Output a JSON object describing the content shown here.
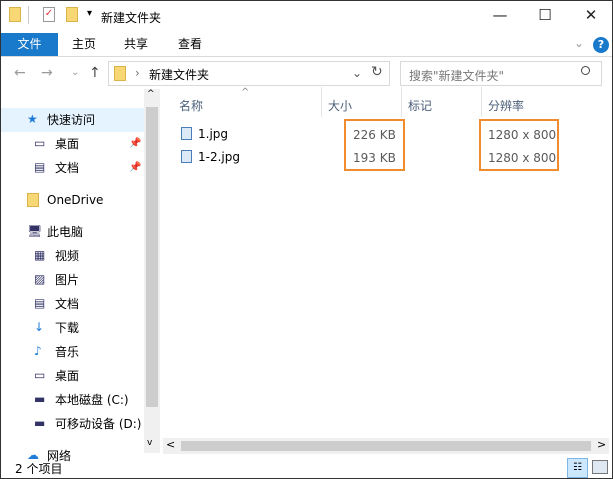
{
  "title_bar": {
    "title": "新建文件夹",
    "minimize": "—",
    "maximize": "☐",
    "close": "✕"
  },
  "ribbon": {
    "tabs": [
      "文件",
      "主页",
      "共享",
      "查看"
    ],
    "help": "?",
    "expand": "⌄"
  },
  "address": {
    "back": "←",
    "forward": "→",
    "recent": "⌄",
    "up": "↑",
    "separator": "›",
    "path": "新建文件夹",
    "dropdown": "⌄",
    "refresh": "↻"
  },
  "search": {
    "placeholder": "搜索\"新建文件夹\"",
    "icon": "search-icon"
  },
  "columns": {
    "name": "名称",
    "size": "大小",
    "tags": "标记",
    "resolution": "分辨率",
    "sort_arrow": "^"
  },
  "files": [
    {
      "name": "1.jpg",
      "size": "226 KB",
      "resolution": "1280 x 800"
    },
    {
      "name": "1-2.jpg",
      "size": "193 KB",
      "resolution": "1280 x 800"
    }
  ],
  "sidebar": {
    "items": [
      {
        "label": "快速访问",
        "icon": "star-icon"
      },
      {
        "label": "桌面",
        "icon": "desktop-icon",
        "pinned": true
      },
      {
        "label": "文档",
        "icon": "document-icon",
        "pinned": true
      },
      {
        "label": "OneDrive",
        "icon": "folder-icon"
      },
      {
        "label": "此电脑",
        "icon": "computer-icon"
      },
      {
        "label": "视频",
        "icon": "video-icon"
      },
      {
        "label": "图片",
        "icon": "picture-icon"
      },
      {
        "label": "文档",
        "icon": "document-icon"
      },
      {
        "label": "下载",
        "icon": "download-icon"
      },
      {
        "label": "音乐",
        "icon": "music-icon"
      },
      {
        "label": "桌面",
        "icon": "desktop-icon"
      },
      {
        "label": "本地磁盘 (C:)",
        "icon": "drive-icon"
      },
      {
        "label": "可移动设备 (D:)",
        "icon": "drive-icon"
      },
      {
        "label": "网络",
        "icon": "network-icon"
      }
    ]
  },
  "status": {
    "count": "2 个项目"
  },
  "colors": {
    "accent": "#1979ca",
    "highlight": "#f08c2e",
    "selected": "#cce8ff"
  }
}
